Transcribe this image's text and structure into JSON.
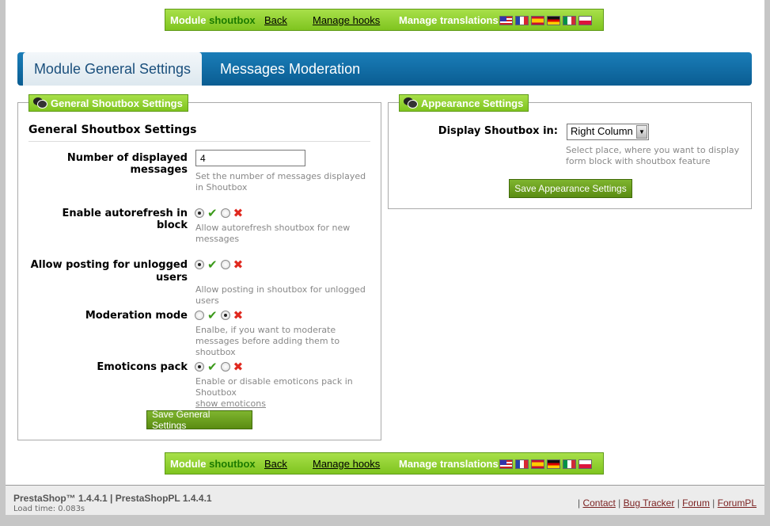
{
  "toolbar": {
    "module_label": "Module",
    "module_name": "shoutbox",
    "back": "Back",
    "manage_hooks": "Manage hooks",
    "manage_translations": "Manage translations:"
  },
  "tabs": [
    {
      "label": "Module General Settings"
    },
    {
      "label": "Messages Moderation"
    }
  ],
  "general": {
    "legend": "General Shoutbox Settings",
    "heading": "General Shoutbox Settings",
    "num_messages": {
      "label": "Number of displayed messages",
      "value": "4",
      "hint": "Set the number of messages displayed in Shoutbox"
    },
    "autorefresh": {
      "label": "Enable autorefresh in block",
      "hint": "Allow autorefresh shoutbox for new messages",
      "selected": "yes"
    },
    "unlogged": {
      "label": "Allow posting for unlogged users",
      "hint": "Allow posting in shoutbox for unlogged users",
      "selected": "yes"
    },
    "moderation": {
      "label": "Moderation mode",
      "hint": "Enalbe, if you want to moderate messages before adding them to shoutbox",
      "selected": "no"
    },
    "emoticons": {
      "label": "Emoticons pack",
      "hint": "Enable or disable emoticons pack in Shoutbox",
      "link": "show emoticons",
      "selected": "yes"
    },
    "save": "Save General Settings"
  },
  "appearance": {
    "legend": "Appearance Settings",
    "display_label": "Display Shoutbox in:",
    "display_value": "Right Column",
    "hint": "Select place, where you want to display form block with shoutbox feature",
    "save": "Save Appearance Settings"
  },
  "footer": {
    "version": "PrestaShop™ 1.4.4.1 | PrestaShopPL 1.4.4.1",
    "load_time": "Load time: 0.083s",
    "sep": "|",
    "links": [
      "Contact",
      "Bug Tracker",
      "Forum",
      "ForumPL"
    ]
  },
  "colors": {
    "accent_green": "#7fc41f",
    "tab_blue": "#0a5d92"
  }
}
